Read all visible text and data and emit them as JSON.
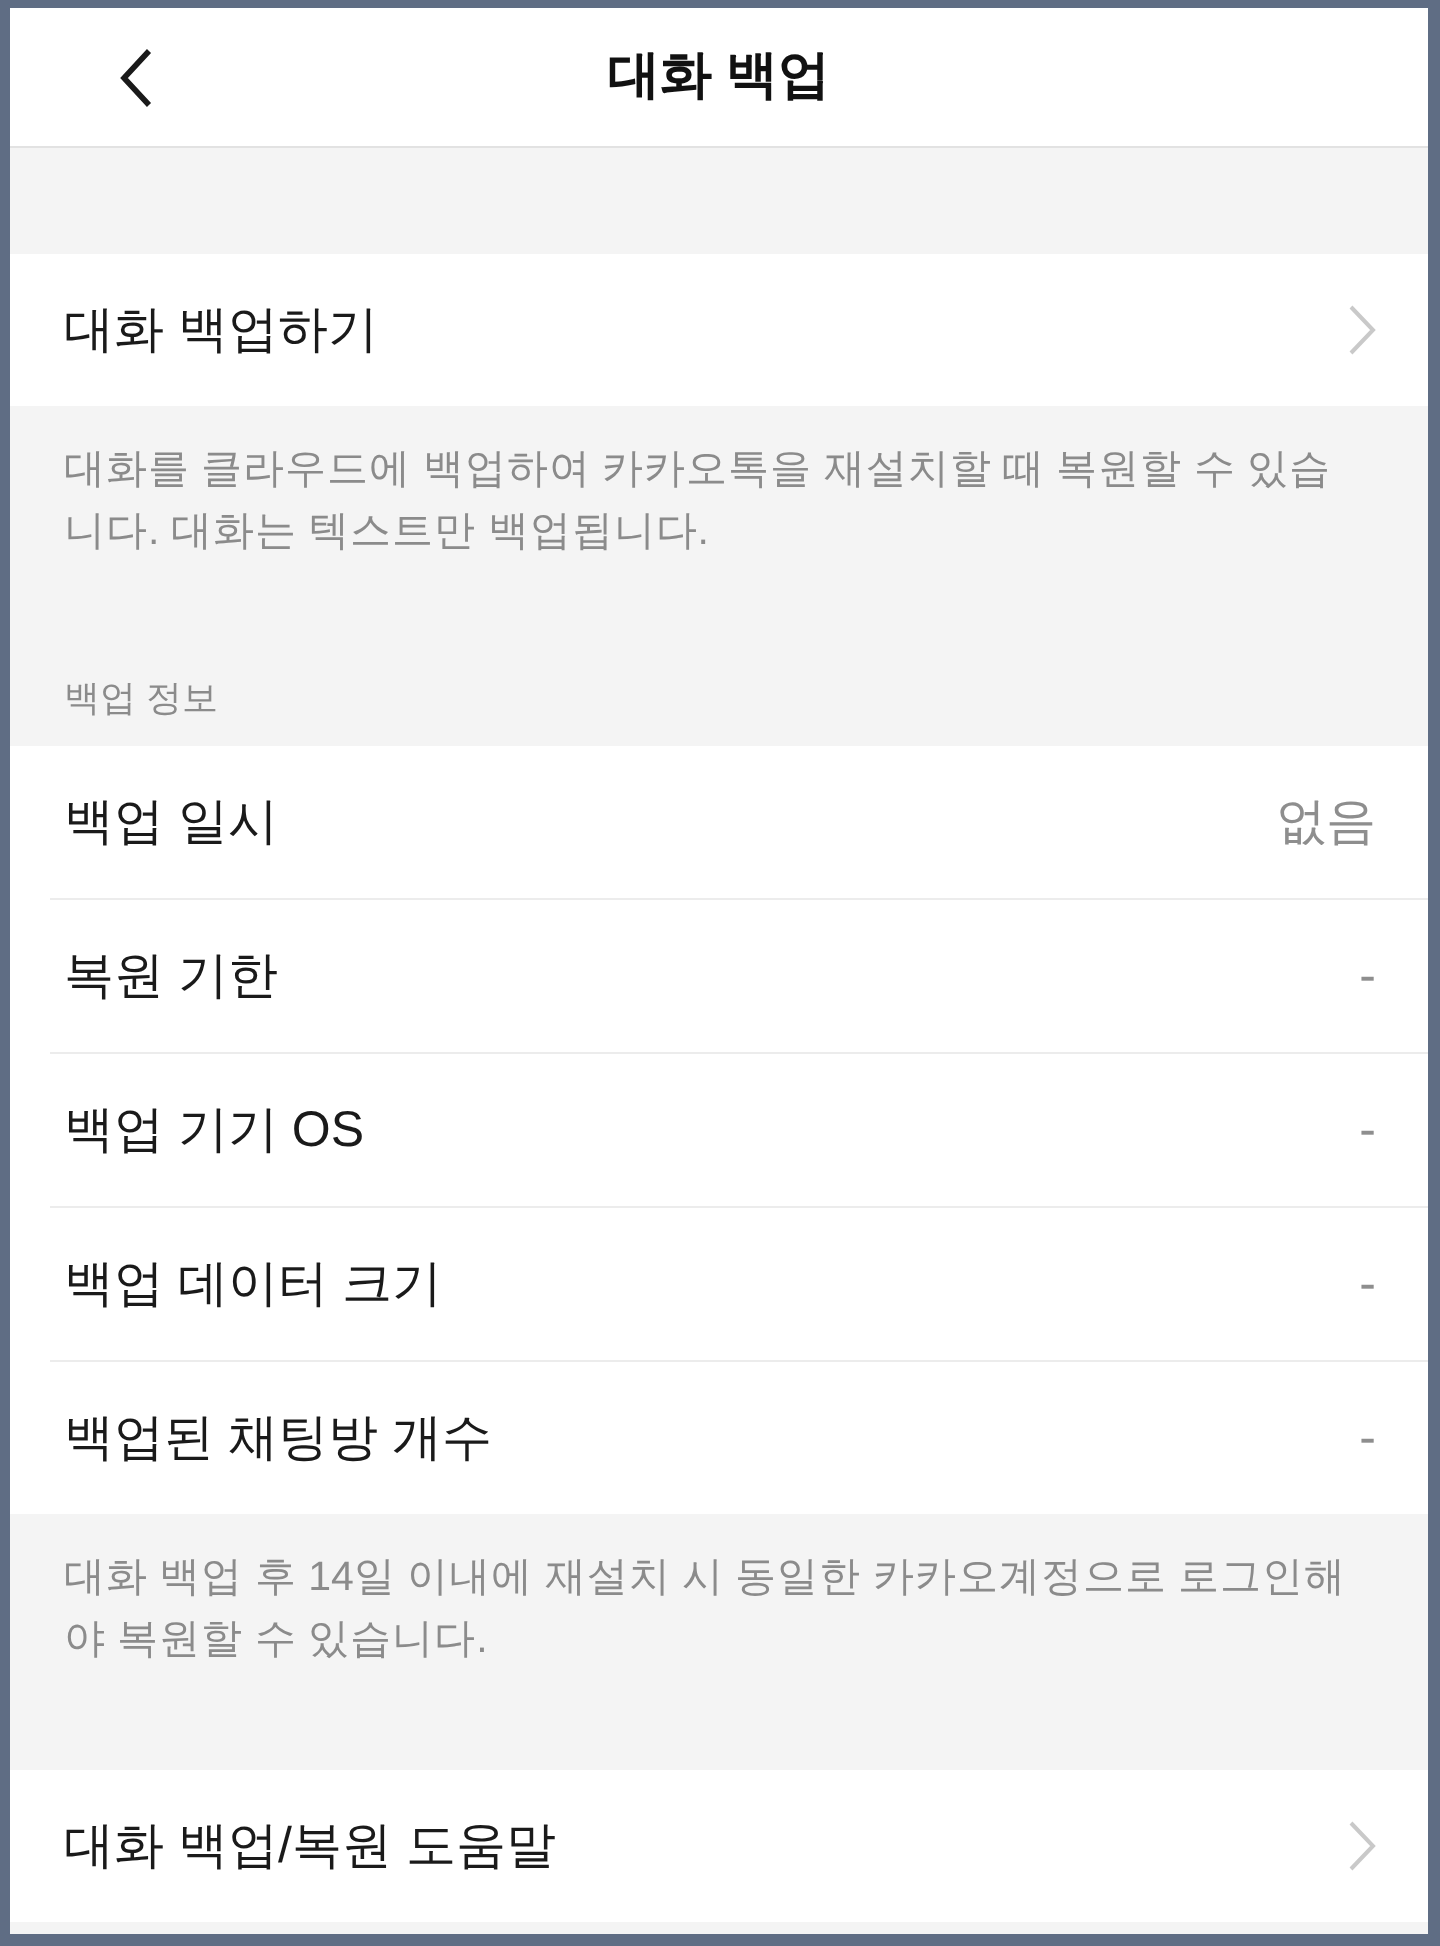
{
  "header": {
    "title": "대화 백업"
  },
  "sections": [
    {
      "rows": [
        {
          "kind": "link",
          "label": "대화 백업하기"
        }
      ],
      "footer": "대화를 클라우드에 백업하여 카카오톡을 재설치할 때 복원할 수 있습니다. 대화는 텍스트만 백업됩니다."
    },
    {
      "title": "백업 정보",
      "rows": [
        {
          "kind": "value",
          "label": "백업 일시",
          "value": "없음"
        },
        {
          "kind": "value",
          "label": "복원 기한",
          "value": "-"
        },
        {
          "kind": "value",
          "label": "백업 기기 OS",
          "value": "-"
        },
        {
          "kind": "value",
          "label": "백업 데이터 크기",
          "value": "-"
        },
        {
          "kind": "value",
          "label": "백업된 채팅방 개수",
          "value": "-"
        }
      ],
      "footer": "대화 백업 후 14일 이내에 재설치 시 동일한 카카오계정으로 로그인해야 복원할 수 있습니다."
    },
    {
      "rows": [
        {
          "kind": "link",
          "label": "대화 백업/복원 도움말"
        }
      ]
    }
  ]
}
